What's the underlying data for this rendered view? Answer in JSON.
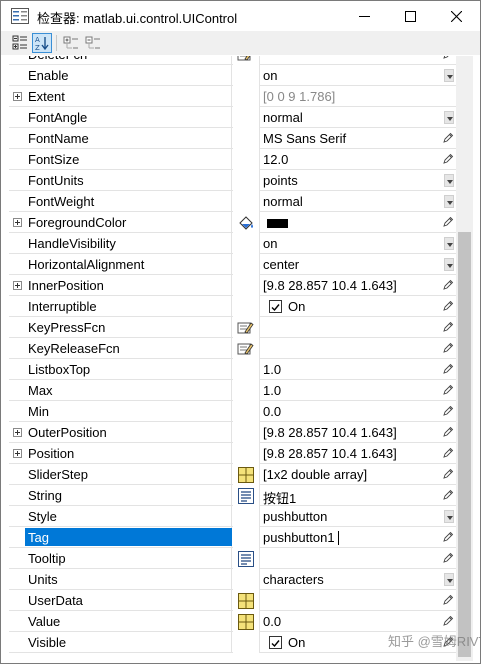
{
  "window": {
    "title": "检查器: matlab.ui.control.UIControl",
    "minimize_icon": "minimize-icon",
    "maximize_icon": "maximize-icon",
    "close_icon": "close-icon"
  },
  "toolbar": {
    "buttons": [
      {
        "name": "categorized-view-icon"
      },
      {
        "name": "alphabetical-view-icon",
        "active": true
      },
      {
        "name": "expand-all-icon"
      },
      {
        "name": "collapse-all-icon"
      }
    ]
  },
  "properties": [
    {
      "name": "DeleteFcn",
      "value": "",
      "type": "callback"
    },
    {
      "name": "Enable",
      "value": "on",
      "type": "dropdown"
    },
    {
      "name": "Extent",
      "value": "[0 0 9 1.786]",
      "type": "readonly",
      "expandable": true
    },
    {
      "name": "FontAngle",
      "value": "normal",
      "type": "dropdown"
    },
    {
      "name": "FontName",
      "value": "MS Sans Serif",
      "type": "text"
    },
    {
      "name": "FontSize",
      "value": "12.0",
      "type": "text"
    },
    {
      "name": "FontUnits",
      "value": "points",
      "type": "dropdown"
    },
    {
      "name": "FontWeight",
      "value": "normal",
      "type": "dropdown"
    },
    {
      "name": "ForegroundColor",
      "value": "",
      "type": "color",
      "expandable": true,
      "color": "#000000"
    },
    {
      "name": "HandleVisibility",
      "value": "on",
      "type": "dropdown"
    },
    {
      "name": "HorizontalAlignment",
      "value": "center",
      "type": "dropdown"
    },
    {
      "name": "InnerPosition",
      "value": "[9.8 28.857 10.4 1.643]",
      "type": "text",
      "expandable": true
    },
    {
      "name": "Interruptible",
      "value": "On",
      "type": "checkbox",
      "checked": true
    },
    {
      "name": "KeyPressFcn",
      "value": "",
      "type": "callback"
    },
    {
      "name": "KeyReleaseFcn",
      "value": "",
      "type": "callback"
    },
    {
      "name": "ListboxTop",
      "value": "1.0",
      "type": "text"
    },
    {
      "name": "Max",
      "value": "1.0",
      "type": "text"
    },
    {
      "name": "Min",
      "value": "0.0",
      "type": "text"
    },
    {
      "name": "OuterPosition",
      "value": "[9.8 28.857 10.4 1.643]",
      "type": "text",
      "expandable": true
    },
    {
      "name": "Position",
      "value": "[9.8 28.857 10.4 1.643]",
      "type": "text",
      "expandable": true
    },
    {
      "name": "SliderStep",
      "value": "[1x2  double array]",
      "type": "array"
    },
    {
      "name": "String",
      "value": "按钮1",
      "type": "stringlist"
    },
    {
      "name": "Style",
      "value": "pushbutton",
      "type": "dropdown"
    },
    {
      "name": "Tag",
      "value": "pushbutton1",
      "type": "text",
      "selected": true,
      "editing": true
    },
    {
      "name": "Tooltip",
      "value": "",
      "type": "stringlist"
    },
    {
      "name": "Units",
      "value": "characters",
      "type": "dropdown"
    },
    {
      "name": "UserData",
      "value": "",
      "type": "array"
    },
    {
      "name": "Value",
      "value": "0.0",
      "type": "array"
    },
    {
      "name": "Visible",
      "value": "On",
      "type": "checkbox",
      "checked": true
    }
  ],
  "watermark": "知乎 @雪姆RIVT",
  "colors": {
    "selection": "#0078d7",
    "grid_line": "#e3e3e3",
    "scroll_thumb": "#c2c2c2"
  }
}
